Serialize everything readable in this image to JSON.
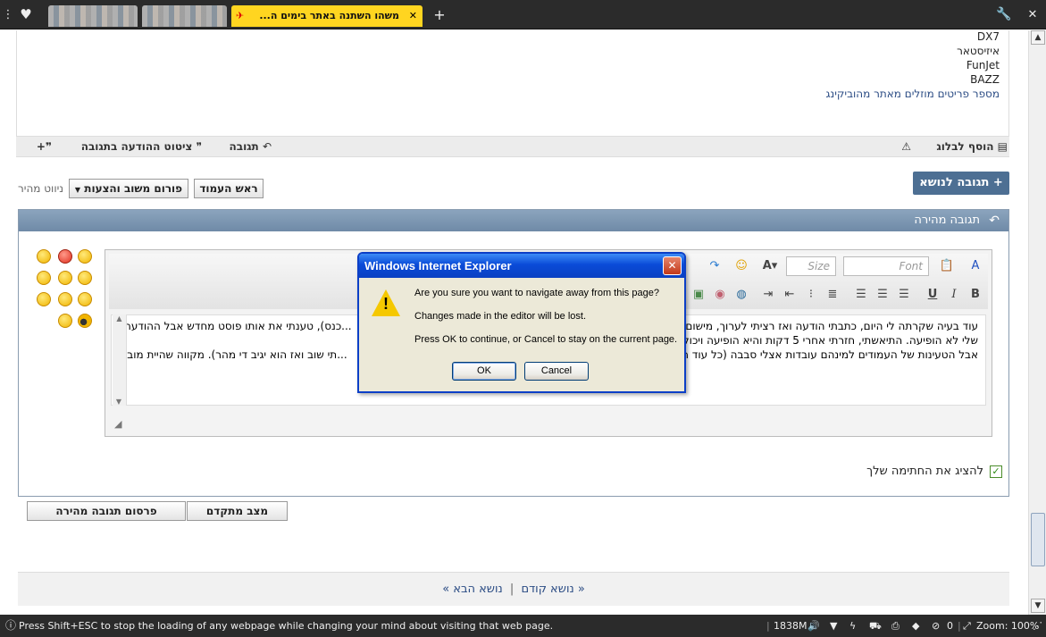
{
  "browser": {
    "tabs": [
      {
        "title": "",
        "state": "blurred"
      },
      {
        "title": "",
        "state": "blurred"
      },
      {
        "title": "משהו השתנה באתר בימים ה...",
        "state": "active"
      }
    ],
    "new_tab_icon": "plus-icon",
    "menu_icon": "wrench-icon",
    "close_icon": "close-icon"
  },
  "post": {
    "lines": [
      "DX7",
      "איזיסטאר",
      "FunJet",
      "BAZZ"
    ],
    "link": "מספר פריטים מוזלים מאתר מהוביקינג"
  },
  "actions": {
    "add_blog": "הוסף לבלוג",
    "reply": "תגובה",
    "quote": "ציטוט ההודעה בתגובה"
  },
  "nav": {
    "reply_topic": "+ תגובה לנושא",
    "quick_nav_label": "ניווט מהיר",
    "forum_select": "פורום משוב והצעות",
    "page_top": "ראש העמוד"
  },
  "quick_reply": {
    "title": "תגובה מהירה",
    "size_placeholder": "Size",
    "font_placeholder": "Font",
    "text_lines": [
      "עוד בעיה שקרתה לי היום, כתבתי הודעה ואז רציתי לערוך, מישום מ...",
      "שלי לא הופיעה. התיאשתי, חזרתי אחרי 5 דקות והיא הופיעה ויכולת...",
      "אבל הטעינות של העמודים למינהם עובדות אצלי סבבה (כל עוד הא..."
    ],
    "text_lines_end": [
      "...כנס), טענתי את אותו פוסט מחדש אבל ההודעה",
      "",
      "...תי שוב ואז הוא יגיב די מהר). מקווה שהיית מובן"
    ],
    "show_signature": "להציג את החתימה שלך",
    "advanced_button": "מצב מתקדם",
    "post_button": "פרסום תגובה מהירה"
  },
  "pager": {
    "prev": "« נושא קודם",
    "separator": "|",
    "next": "נושא הבא »"
  },
  "dialog": {
    "title": "Windows Internet Explorer",
    "line1": "Are you sure you want to navigate away from this page?",
    "line2": "Changes made in the editor will be lost.",
    "line3": "Press OK to continue, or Cancel to stay on the current page.",
    "ok": "OK",
    "cancel": "Cancel"
  },
  "status": {
    "message": "Press Shift+ESC to stop the loading of any webpage while changing your mind about visiting that web page.",
    "memory": "1838M",
    "counter": "0",
    "zoom": "Zoom: 100%"
  }
}
